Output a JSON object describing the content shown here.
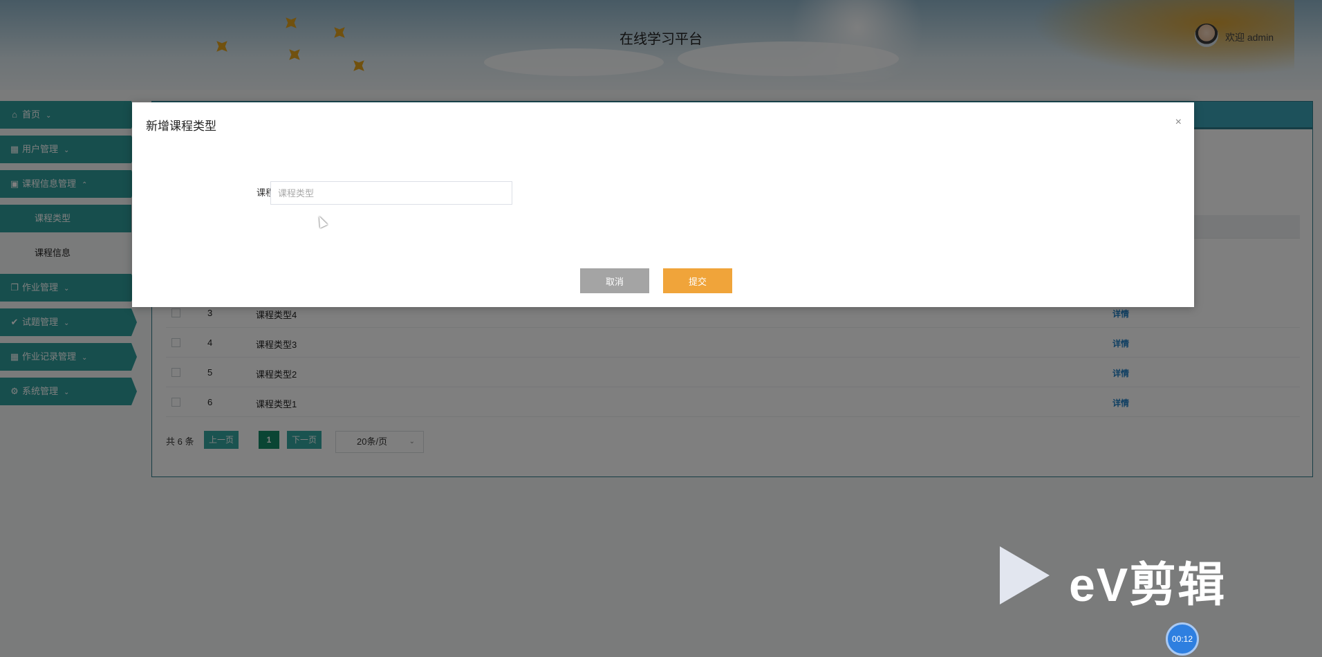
{
  "header": {
    "site_title": "在线学习平台",
    "welcome": "欢迎 admin"
  },
  "sidebar": {
    "items": [
      {
        "label": "首页",
        "icon": "home-icon"
      },
      {
        "label": "用户管理",
        "icon": "grid-icon"
      },
      {
        "label": "课程信息管理",
        "icon": "apps-icon",
        "expanded": true,
        "children": [
          {
            "label": "课程类型",
            "active": true
          },
          {
            "label": "课程信息",
            "active": false
          }
        ]
      },
      {
        "label": "作业管理",
        "icon": "copy-icon"
      },
      {
        "label": "试题管理",
        "icon": "check-circle-icon"
      },
      {
        "label": "作业记录管理",
        "icon": "grid-icon"
      },
      {
        "label": "系统管理",
        "icon": "settings-icon"
      }
    ]
  },
  "table": {
    "action_label": "详情",
    "rows": [
      {
        "num": "3",
        "name": "课程类型4"
      },
      {
        "num": "4",
        "name": "课程类型3"
      },
      {
        "num": "5",
        "name": "课程类型2"
      },
      {
        "num": "6",
        "name": "课程类型1"
      }
    ]
  },
  "pagination": {
    "total": "共 6 条",
    "prev": "上一页",
    "current": "1",
    "next": "下一页",
    "page_size": "20条/页"
  },
  "dialog": {
    "title": "新增课程类型",
    "close": "×",
    "field_label": "课程类型",
    "field_placeholder": "课程类型",
    "field_value": "",
    "cancel": "取消",
    "submit": "提交"
  },
  "watermark": {
    "brand": "eV剪辑",
    "timer": "00:12"
  },
  "colors": {
    "sidebar": "#2f9c9a",
    "submit": "#f0a43a",
    "cancel": "#a4a4a4",
    "link": "#1e7fc4"
  }
}
